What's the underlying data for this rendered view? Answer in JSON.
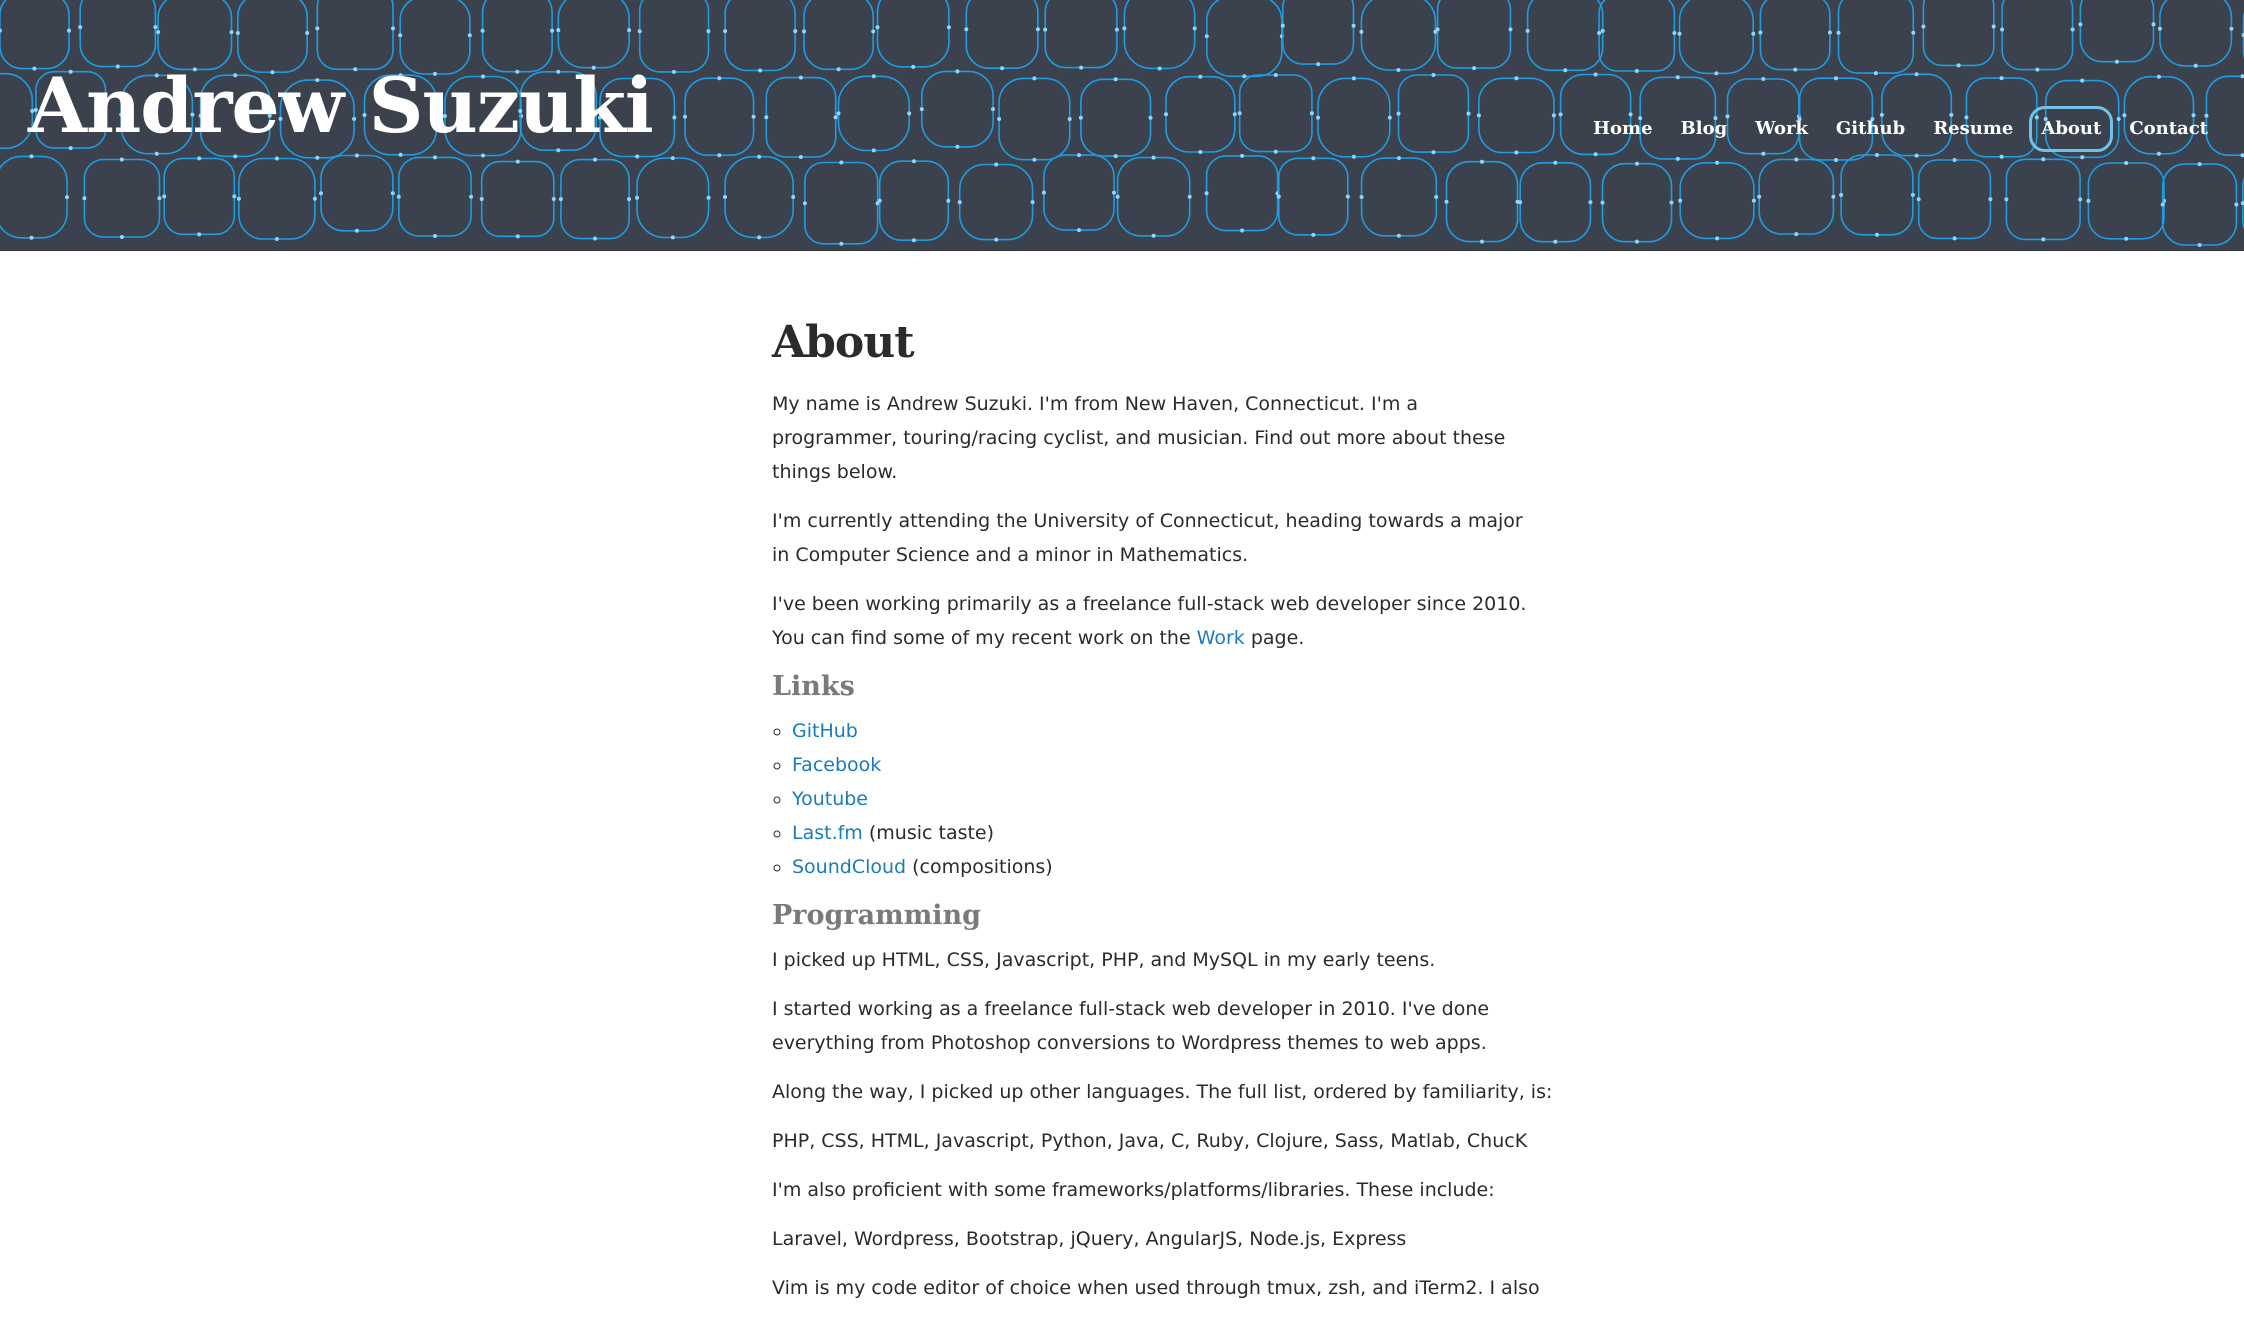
{
  "header": {
    "site_title": "Andrew Suzuki",
    "nav": [
      "Home",
      "Blog",
      "Work",
      "Github",
      "Resume",
      "About",
      "Contact"
    ],
    "active_nav": "About",
    "colors": {
      "background": "#3c424d",
      "pattern_line": "#1f9be0",
      "active_ring": "#6fc3ea"
    }
  },
  "main": {
    "title": "About",
    "intro": [
      "My name is Andrew Suzuki. I'm from New Haven, Connecticut. I'm a",
      "programmer, touring/racing cyclist, and musician. Find out more about these",
      "things below."
    ],
    "education": [
      "I'm currently attending the University of Connecticut, heading towards a major",
      "in Computer Science and a minor in Mathematics."
    ],
    "work_line1": "I've been working primarily as a freelance full-stack web developer since 2010.",
    "work_line2_prefix": "You can find some of my recent work on the ",
    "work_link": "Work",
    "work_line2_suffix": " page.",
    "links_heading": "Links",
    "links": [
      {
        "text": "GitHub",
        "note": ""
      },
      {
        "text": "Facebook",
        "note": ""
      },
      {
        "text": "Youtube",
        "note": ""
      },
      {
        "text": "Last.fm",
        "note": " (music taste)"
      },
      {
        "text": "SoundCloud",
        "note": " (compositions)"
      }
    ],
    "programming_heading": "Programming",
    "programming": [
      "I picked up HTML, CSS, Javascript, PHP, and MySQL in my early teens.",
      "I started working as a freelance full-stack web developer in 2010. I've done",
      "everything from Photoshop conversions to Wordpress themes to web apps.",
      "Along the way, I picked up other languages. The full list, ordered by familiarity, is:",
      "PHP, CSS, HTML, Javascript, Python, Java, C, Ruby, Clojure, Sass, Matlab, ChucK",
      "I'm also proficient with some frameworks/platforms/libraries. These include:",
      "Laravel, Wordpress, Bootstrap, jQuery, AngularJS, Node.js, Express",
      "Vim is my code editor of choice when used through tmux, zsh, and iTerm2. I also"
    ],
    "link_color": "#1a7bbd"
  }
}
